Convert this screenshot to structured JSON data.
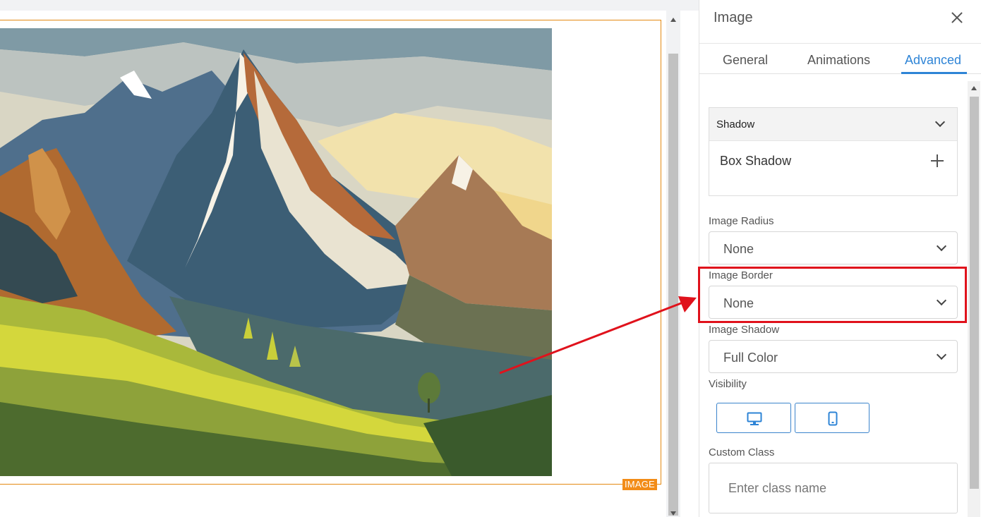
{
  "canvas": {
    "image_badge": "IMAGE"
  },
  "panel": {
    "title": "Image",
    "tabs": [
      {
        "label": "General",
        "active": false
      },
      {
        "label": "Animations",
        "active": false
      },
      {
        "label": "Advanced",
        "active": true
      }
    ],
    "shadow_section": {
      "header": "Shadow",
      "box_shadow_label": "Box Shadow"
    },
    "image_radius": {
      "label": "Image Radius",
      "value": "None"
    },
    "image_border": {
      "label": "Image Border",
      "value": "None"
    },
    "image_shadow": {
      "label": "Image Shadow",
      "value": "Full Color"
    },
    "visibility": {
      "label": "Visibility",
      "buttons": [
        "desktop-icon",
        "mobile-icon"
      ]
    },
    "custom_class": {
      "label": "Custom Class",
      "placeholder": "Enter class name",
      "value": ""
    }
  },
  "colors": {
    "accent": "#2e84d6",
    "image_frame": "#e48a12",
    "highlight": "#e0121c"
  }
}
